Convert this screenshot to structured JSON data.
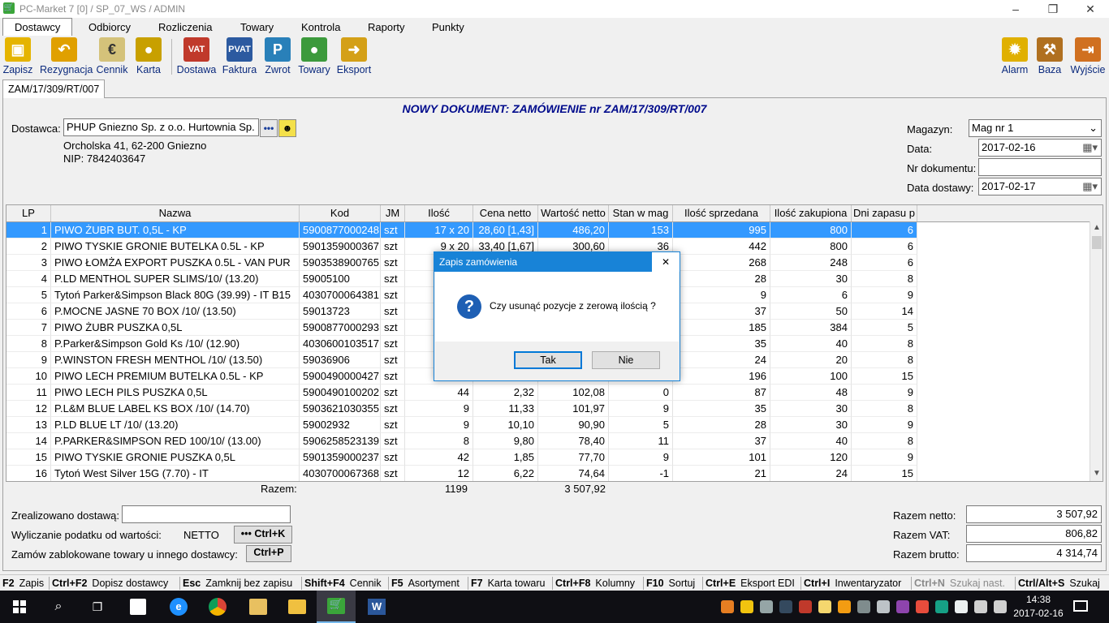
{
  "window": {
    "title": "PC-Market 7 [0] / SP_07_WS / ADMIN",
    "minimize": "–",
    "maximize": "❐",
    "close": "✕"
  },
  "menu": [
    "Dostawcy",
    "Odbiorcy",
    "Rozliczenia",
    "Towary",
    "Kontrola",
    "Raporty",
    "Punkty"
  ],
  "toolbar": {
    "left": [
      {
        "label": "Zapisz",
        "icon": "floppy-disk-icon",
        "color": "#e5b400"
      },
      {
        "label": "Rezygnacja",
        "icon": "undo-arrow-icon",
        "color": "#e0a000"
      },
      {
        "label": "Cennik",
        "icon": "price-list-icon",
        "color": "#d4c27a"
      },
      {
        "label": "Karta",
        "icon": "apple-card-icon",
        "color": "#c8a000"
      }
    ],
    "mid": [
      {
        "label": "Dostawa",
        "icon": "vat-truck-icon",
        "color": "#c0392b"
      },
      {
        "label": "Faktura",
        "icon": "pvat-invoice-icon",
        "color": "#2c5aa0"
      },
      {
        "label": "Zwrot",
        "icon": "return-icon",
        "color": "#2980b9"
      },
      {
        "label": "Towary",
        "icon": "goods-apple-icon",
        "color": "#3c9a3c"
      },
      {
        "label": "Eksport",
        "icon": "export-icon",
        "color": "#d4a017"
      }
    ],
    "right": [
      {
        "label": "Alarm",
        "icon": "alarm-icon",
        "color": "#e0b000"
      },
      {
        "label": "Baza",
        "icon": "database-tools-icon",
        "color": "#b07020"
      },
      {
        "label": "Wyjście",
        "icon": "exit-door-icon",
        "color": "#d07020"
      }
    ]
  },
  "doc_tab": "ZAM/17/309/RT/007",
  "heading": "NOWY DOKUMENT: ZAMÓWIENIE nr ZAM/17/309/RT/007",
  "supplier": {
    "label": "Dostawca:",
    "name": "PHUP Gniezno Sp. z o.o. Hurtownia Sp.",
    "address": "Orcholska 41, 62-200 Gniezno",
    "nip": "NIP: 7842403647",
    "dots_btn": "•••"
  },
  "right_form": {
    "warehouse_label": "Magazyn:",
    "warehouse_value": "Mag nr 1",
    "date_label": "Data:",
    "date_value": "2017-02-16",
    "docnum_label": "Nr dokumentu:",
    "docnum_value": "",
    "delivery_label": "Data dostawy:",
    "delivery_value": "2017-02-17"
  },
  "grid": {
    "columns": [
      "LP",
      "Nazwa",
      "Kod",
      "JM",
      "Ilość",
      "Cena netto",
      "Wartość netto",
      "Stan w mag",
      "Ilość sprzedana",
      "Ilość zakupiona",
      "Dni zapasu p"
    ],
    "rows": [
      [
        "1",
        "PIWO ŻUBR BUT. 0,5L - KP",
        "5900877000248",
        "szt",
        "17 x 20",
        "28,60 [1,43]",
        "486,20",
        "153",
        "995",
        "800",
        "6"
      ],
      [
        "2",
        "PIWO TYSKIE GRONIE BUTELKA 0.5L - KP",
        "5901359000367",
        "szt",
        "9 x 20",
        "33,40 [1,67]",
        "300,60",
        "36",
        "442",
        "800",
        "6"
      ],
      [
        "3",
        "PIWO ŁOMŻA EXPORT PUSZKA 0.5L - VAN PUR",
        "5903538900765",
        "szt",
        "",
        "",
        "",
        "",
        "268",
        "248",
        "6"
      ],
      [
        "4",
        "P.LD MENTHOL SUPER SLIMS/10/ (13.20)",
        "59005100",
        "szt",
        "",
        "",
        "",
        "",
        "28",
        "30",
        "8"
      ],
      [
        "5",
        "Tytoń Parker&Simpson Black 80G (39.99) - IT B15",
        "4030700064381",
        "szt",
        "",
        "",
        "",
        "",
        "9",
        "6",
        "9"
      ],
      [
        "6",
        "P.MOCNE JASNE 70 BOX /10/ (13.50)",
        "59013723",
        "szt",
        "",
        "",
        "",
        "",
        "37",
        "50",
        "14"
      ],
      [
        "7",
        "PIWO ŻUBR PUSZKA 0,5L",
        "5900877000293",
        "szt",
        "",
        "",
        "",
        "",
        "185",
        "384",
        "5"
      ],
      [
        "8",
        "P.Parker&Simpson Gold Ks /10/ (12.90)",
        "4030600103517",
        "szt",
        "",
        "",
        "",
        "",
        "35",
        "40",
        "8"
      ],
      [
        "9",
        "P.WINSTON FRESH MENTHOL /10/ (13.50)",
        "59036906",
        "szt",
        "",
        "",
        "",
        "",
        "24",
        "20",
        "8"
      ],
      [
        "10",
        "PIWO LECH PREMIUM BUTELKA 0.5L - KP",
        "5900490000427",
        "szt",
        "",
        "",
        "",
        "",
        "196",
        "100",
        "15"
      ],
      [
        "11",
        "PIWO LECH PILS PUSZKA 0,5L",
        "5900490100202",
        "szt",
        "44",
        "2,32",
        "102,08",
        "0",
        "87",
        "48",
        "9"
      ],
      [
        "12",
        "P.L&M BLUE LABEL KS BOX /10/ (14.70)",
        "5903621030355",
        "szt",
        "9",
        "11,33",
        "101,97",
        "9",
        "35",
        "30",
        "8"
      ],
      [
        "13",
        "P.LD BLUE LT /10/ (13.20)",
        "59002932",
        "szt",
        "9",
        "10,10",
        "90,90",
        "5",
        "28",
        "30",
        "9"
      ],
      [
        "14",
        "P.PARKER&SIMPSON RED 100/10/ (13.00)",
        "5906258523139",
        "szt",
        "8",
        "9,80",
        "78,40",
        "11",
        "37",
        "40",
        "8"
      ],
      [
        "15",
        "PIWO TYSKIE GRONIE PUSZKA 0,5L",
        "5901359000237",
        "szt",
        "42",
        "1,85",
        "77,70",
        "9",
        "101",
        "120",
        "9"
      ],
      [
        "16",
        "Tytoń West Silver 15G (7.70) - IT",
        "4030700067368",
        "szt",
        "12",
        "6,22",
        "74,64",
        "-1",
        "21",
        "24",
        "15"
      ]
    ],
    "totals_label": "Razem:",
    "total_qty": "1199",
    "total_value": "3 507,92"
  },
  "bottom": {
    "realized_label": "Zrealizowano dostawą:",
    "tax_label": "Wyliczanie podatku od wartości:",
    "tax_value": "NETTO",
    "tax_btn": "••• Ctrl+K",
    "blocked_label": "Zamów zablokowane towary u innego dostawcy:",
    "blocked_btn": "Ctrl+P",
    "net_label": "Razem netto:",
    "net_value": "3 507,92",
    "vat_label": "Razem VAT:",
    "vat_value": "806,82",
    "gross_label": "Razem brutto:",
    "gross_value": "4 314,74"
  },
  "fkeys": [
    {
      "key": "F2",
      "label": "Zapis"
    },
    {
      "key": "Ctrl+F2",
      "label": "Dopisz dostawcy"
    },
    {
      "key": "Esc",
      "label": "Zamknij bez zapisu"
    },
    {
      "key": "Shift+F4",
      "label": "Cennik"
    },
    {
      "key": "F5",
      "label": "Asortyment"
    },
    {
      "key": "F7",
      "label": "Karta towaru"
    },
    {
      "key": "Ctrl+F8",
      "label": "Kolumny"
    },
    {
      "key": "F10",
      "label": "Sortuj"
    },
    {
      "key": "Ctrl+E",
      "label": "Eksport EDI"
    },
    {
      "key": "Ctrl+I",
      "label": "Inwentaryzator"
    },
    {
      "key": "Ctrl+N",
      "label": "Szukaj nast."
    },
    {
      "key": "Ctrl/Alt+S",
      "label": "Szukaj"
    }
  ],
  "dialog": {
    "title": "Zapis zamówienia",
    "message": "Czy usunąć pozycje z zerową ilością ?",
    "yes": "Tak",
    "no": "Nie",
    "close": "✕",
    "icon": "question-icon"
  },
  "taskbar": {
    "time": "14:38",
    "date": "2017-02-16"
  }
}
